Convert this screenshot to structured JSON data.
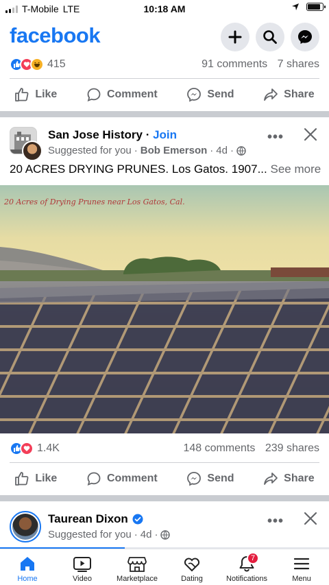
{
  "status": {
    "carrier": "T-Mobile",
    "network": "LTE",
    "time": "10:18 AM"
  },
  "header": {
    "logo": "facebook",
    "buttons": [
      "plus-icon",
      "search-icon",
      "messenger-icon"
    ]
  },
  "prev_post": {
    "reaction_count": "415",
    "comments": "91 comments",
    "shares": "7 shares",
    "actions": {
      "like": "Like",
      "comment": "Comment",
      "send": "Send",
      "share": "Share"
    }
  },
  "post": {
    "page_name": "San Jose History",
    "separator": "·",
    "join": "Join",
    "suggested": "Suggested for you",
    "author": "Bob Emerson",
    "age": "4d",
    "text": "20 ACRES DRYING PRUNES. Los Gatos. 1907...",
    "see_more": "See more",
    "image_caption": "20 Acres of Drying Prunes near Los Gatos, Cal.",
    "reaction_count": "1.4K",
    "comments": "148 comments",
    "shares": "239 shares",
    "actions": {
      "like": "Like",
      "comment": "Comment",
      "send": "Send",
      "share": "Share"
    }
  },
  "next_post": {
    "name": "Taurean Dixon",
    "suggested": "Suggested for you",
    "age": "4d"
  },
  "nav": {
    "items": [
      {
        "label": "Home",
        "icon": "home-icon"
      },
      {
        "label": "Video",
        "icon": "video-icon"
      },
      {
        "label": "Marketplace",
        "icon": "marketplace-icon"
      },
      {
        "label": "Dating",
        "icon": "dating-icon"
      },
      {
        "label": "Notifications",
        "icon": "bell-icon"
      },
      {
        "label": "Menu",
        "icon": "menu-icon"
      }
    ],
    "notifications_badge": "7"
  },
  "colors": {
    "brand": "#1877f2",
    "secondary_text": "#65676b",
    "badge": "#e41e3f"
  }
}
